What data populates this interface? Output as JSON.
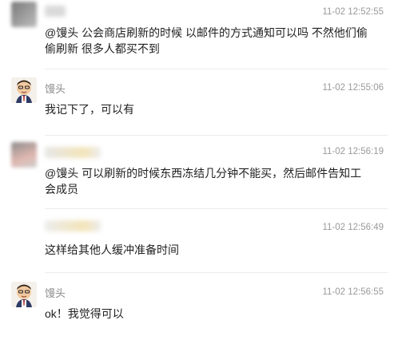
{
  "messages": [
    {
      "name": "",
      "time": "11-02 12:52:55",
      "text": "@馒头 公会商店刷新的时候 以邮件的方式通知可以吗 不然他们偷偷刷新 很多人都买不到"
    },
    {
      "name": "馒头",
      "time": "11-02 12:55:06",
      "text": "我记下了，可以有"
    },
    {
      "name": "",
      "time": "11-02 12:56:19",
      "text": "@馒头 可以刷新的时候东西冻结几分钟不能买，然后邮件告知工会成员"
    },
    {
      "name": "",
      "time": "11-02 12:56:49",
      "text": "这样给其他人缓冲准备时间"
    },
    {
      "name": "馒头",
      "time": "11-02 12:56:55",
      "text": "ok！我觉得可以"
    }
  ]
}
